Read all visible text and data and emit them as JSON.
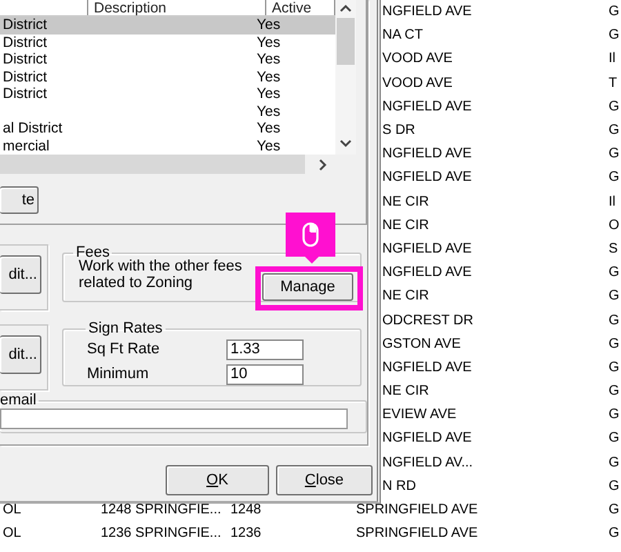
{
  "background_list": {
    "rows": [
      {
        "kind": "partial",
        "street": "NGFIELD AVE",
        "code": "G"
      },
      {
        "kind": "partial",
        "street": "NA CT",
        "code": "G"
      },
      {
        "kind": "partial",
        "street": "VOOD AVE",
        "code": "Il"
      },
      {
        "kind": "partial",
        "street": "VOOD AVE",
        "code": "T"
      },
      {
        "kind": "partial",
        "street": "NGFIELD AVE",
        "code": "G"
      },
      {
        "kind": "partial",
        "street": "S DR",
        "code": "G"
      },
      {
        "kind": "partial",
        "street": "NGFIELD AVE",
        "code": "G"
      },
      {
        "kind": "partial",
        "street": "NGFIELD AVE",
        "code": "G"
      },
      {
        "kind": "partial",
        "street": "NE CIR",
        "code": "Il"
      },
      {
        "kind": "partial",
        "street": "NE CIR",
        "code": "O"
      },
      {
        "kind": "partial",
        "street": "NGFIELD AVE",
        "code": "S"
      },
      {
        "kind": "partial",
        "street": "NGFIELD AVE",
        "code": "G"
      },
      {
        "kind": "partial",
        "street": "NE CIR",
        "code": "G"
      },
      {
        "kind": "partial",
        "street": "ODCREST DR",
        "code": "G"
      },
      {
        "kind": "partial",
        "street": "GSTON AVE",
        "code": "G"
      },
      {
        "kind": "partial",
        "street": "NGFIELD AVE",
        "code": "G"
      },
      {
        "kind": "partial",
        "street": "NE CIR",
        "code": "G"
      },
      {
        "kind": "partial",
        "street": "EVIEW AVE",
        "code": "G"
      },
      {
        "kind": "partial",
        "street": "NGFIELD AVE",
        "code": "G"
      },
      {
        "kind": "partial",
        "street": "NGFIELD AV...",
        "code": "G"
      },
      {
        "kind": "partial",
        "street": "N RD",
        "code": "G"
      },
      {
        "kind": "full",
        "column_1": "OL",
        "column_2": "1248 SPRINGFIE...",
        "column_3": "1248",
        "street": "SPRINGFIELD AVE",
        "code": "G"
      },
      {
        "kind": "full",
        "column_1": "OL",
        "column_2": "1236 SPRINGFIE...",
        "column_3": "1236",
        "street": "SPRINGFIELD AVE",
        "code": "G"
      }
    ]
  },
  "dialog": {
    "list": {
      "columns": [
        "Description",
        "Active"
      ],
      "rows": [
        {
          "name": "District",
          "active": "Yes",
          "selected": true
        },
        {
          "name": "District",
          "active": "Yes",
          "selected": false
        },
        {
          "name": "District",
          "active": "Yes",
          "selected": false
        },
        {
          "name": "District",
          "active": "Yes",
          "selected": false
        },
        {
          "name": "District",
          "active": "Yes",
          "selected": false
        },
        {
          "active": "Yes",
          "selected": false
        },
        {
          "name": "al District",
          "active": "Yes",
          "selected": false
        },
        {
          "name": "mercial",
          "active": "Yes",
          "selected": false
        }
      ]
    },
    "delete_button": "te",
    "edit_buttons": [
      "dit...",
      "dit..."
    ],
    "fees": {
      "title": "Fees",
      "text": "Work with the other fees related to Zoning",
      "button": "Manage",
      "highlighted": true
    },
    "sign_rates": {
      "title": "Sign Rates",
      "fields": [
        {
          "label": "Sq Ft Rate",
          "value": "1.33"
        },
        {
          "label": "Minimum",
          "value": "10"
        }
      ]
    },
    "email": {
      "title": "email"
    },
    "buttons": [
      "OK",
      "Close"
    ]
  }
}
